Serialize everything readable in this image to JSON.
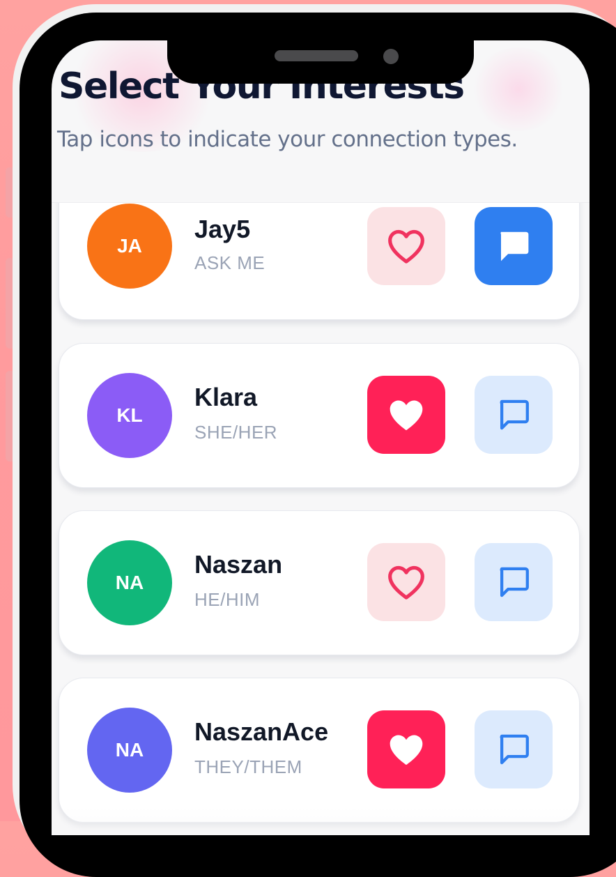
{
  "header": {
    "title": "Select Your Interests",
    "subtitle": "Tap icons to indicate your connection types."
  },
  "colors": {
    "background": "#ff9c9e",
    "heart_active": "#ff2157",
    "heart_inactive_bg": "#fbe2e4",
    "heart_inactive_icon": "#f0335f",
    "message_active": "#2f7ff0",
    "message_inactive_bg": "#dceafd",
    "message_inactive_icon": "#2f7ff0"
  },
  "contacts": [
    {
      "initials": "JA",
      "name": "Jay5",
      "pronouns": "ASK ME",
      "avatar_color": "#f97316",
      "heart_selected": false,
      "message_selected": true,
      "heart_icon": "heart-outline-icon",
      "message_icon": "chat-bubble-filled-icon"
    },
    {
      "initials": "KL",
      "name": "Klara",
      "pronouns": "SHE/HER",
      "avatar_color": "#8b5cf6",
      "heart_selected": true,
      "message_selected": false,
      "heart_icon": "heart-filled-icon",
      "message_icon": "chat-bubble-outline-icon"
    },
    {
      "initials": "NA",
      "name": "Naszan",
      "pronouns": "HE/HIM",
      "avatar_color": "#11b77a",
      "heart_selected": false,
      "message_selected": false,
      "heart_icon": "heart-outline-icon",
      "message_icon": "chat-bubble-outline-icon"
    },
    {
      "initials": "NA",
      "name": "NaszanAce",
      "pronouns": "THEY/THEM",
      "avatar_color": "#6366f1",
      "heart_selected": true,
      "message_selected": false,
      "heart_icon": "heart-filled-icon",
      "message_icon": "chat-bubble-outline-icon"
    }
  ]
}
